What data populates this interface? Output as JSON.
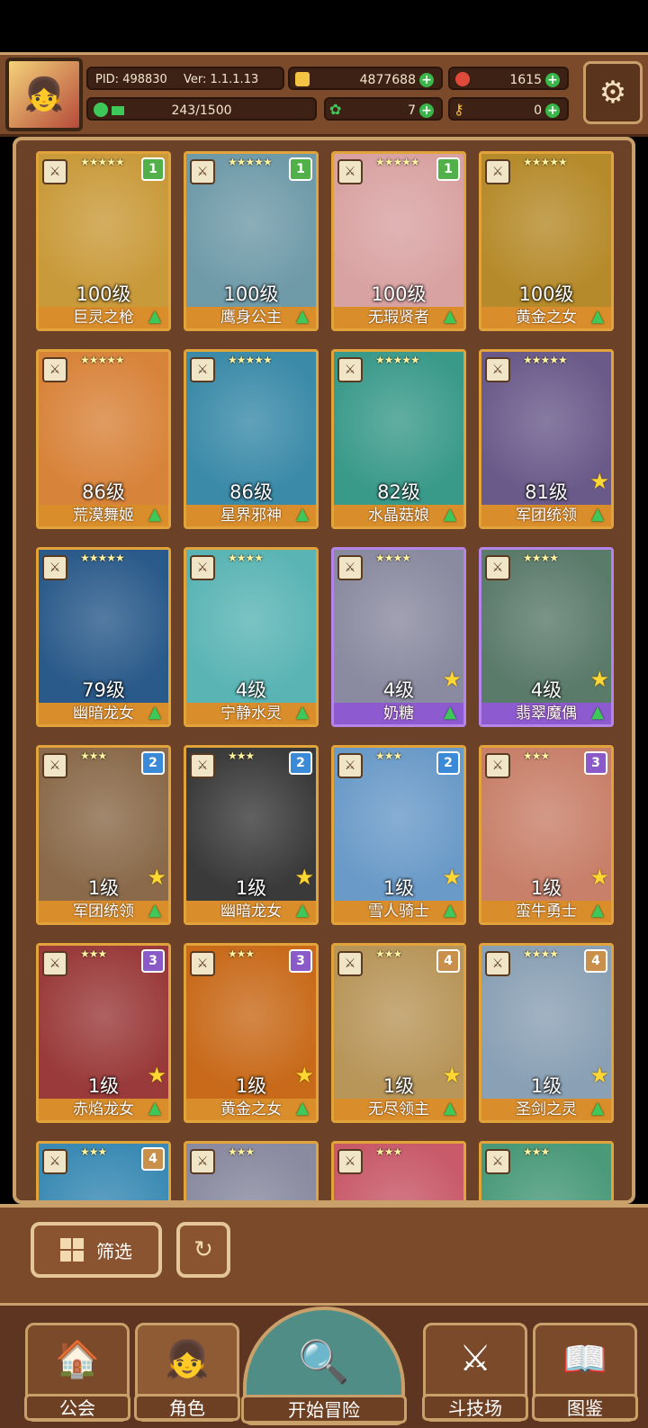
{
  "header": {
    "pid": "PID: 498830",
    "version": "Ver: 1.1.1.13",
    "gold": "4877688",
    "gems": "1615",
    "exp": "243/1500",
    "clover": "7",
    "keys": "0"
  },
  "cards": [
    {
      "stars": "★★★★★",
      "rank": "1",
      "rank_color": "#52b04a",
      "level": "100级",
      "name": "巨灵之枪",
      "art": "#c99a3a",
      "purple": false,
      "star_badge": false
    },
    {
      "stars": "★★★★★",
      "rank": "1",
      "rank_color": "#52b04a",
      "level": "100级",
      "name": "鹰身公主",
      "art": "#6f9aa8",
      "purple": false,
      "star_badge": false
    },
    {
      "stars": "★★★★★",
      "rank": "1",
      "rank_color": "#52b04a",
      "level": "100级",
      "name": "无瑕贤者",
      "art": "#d9a2a2",
      "purple": false,
      "star_badge": false
    },
    {
      "stars": "★★★★★",
      "rank": "",
      "rank_color": "",
      "level": "100级",
      "name": "黄金之女",
      "art": "#b58a2a",
      "purple": false,
      "star_badge": false
    },
    {
      "stars": "★★★★★",
      "rank": "",
      "rank_color": "",
      "level": "86级",
      "name": "荒漠舞姬",
      "art": "#d8833a",
      "purple": false,
      "star_badge": false
    },
    {
      "stars": "★★★★★",
      "rank": "",
      "rank_color": "",
      "level": "86级",
      "name": "星界邪神",
      "art": "#3a8aa8",
      "purple": false,
      "star_badge": false
    },
    {
      "stars": "★★★★★",
      "rank": "",
      "rank_color": "",
      "level": "82级",
      "name": "水晶菇娘",
      "art": "#3a9a8a",
      "purple": false,
      "star_badge": false
    },
    {
      "stars": "★★★★★",
      "rank": "",
      "rank_color": "",
      "level": "81级",
      "name": "军团统领",
      "art": "#6a5a8a",
      "purple": false,
      "star_badge": true
    },
    {
      "stars": "★★★★★",
      "rank": "",
      "rank_color": "",
      "level": "79级",
      "name": "幽暗龙女",
      "art": "#2a5a8a",
      "purple": false,
      "star_badge": false
    },
    {
      "stars": "★★★★",
      "rank": "",
      "rank_color": "",
      "level": "4级",
      "name": "宁静水灵",
      "art": "#5ab4b4",
      "purple": false,
      "star_badge": false
    },
    {
      "stars": "★★★★",
      "rank": "",
      "rank_color": "",
      "level": "4级",
      "name": "奶糖",
      "art": "#8a8aa0",
      "purple": true,
      "star_badge": true
    },
    {
      "stars": "★★★★",
      "rank": "",
      "rank_color": "",
      "level": "4级",
      "name": "翡翠魔偶",
      "art": "#5a7a6a",
      "purple": true,
      "star_badge": true
    },
    {
      "stars": "★★★",
      "rank": "2",
      "rank_color": "#3a8ad8",
      "level": "1级",
      "name": "军团统领",
      "art": "#8a6a4a",
      "purple": false,
      "star_badge": true
    },
    {
      "stars": "★★★",
      "rank": "2",
      "rank_color": "#3a8ad8",
      "level": "1级",
      "name": "幽暗龙女",
      "art": "#3a3a3a",
      "purple": false,
      "star_badge": true
    },
    {
      "stars": "★★★",
      "rank": "2",
      "rank_color": "#3a8ad8",
      "level": "1级",
      "name": "雪人骑士",
      "art": "#6a9ac8",
      "purple": false,
      "star_badge": true
    },
    {
      "stars": "★★★",
      "rank": "3",
      "rank_color": "#8a5ac8",
      "level": "1级",
      "name": "蛮牛勇士",
      "art": "#c8806a",
      "purple": false,
      "star_badge": true
    },
    {
      "stars": "★★★",
      "rank": "3",
      "rank_color": "#8a5ac8",
      "level": "1级",
      "name": "赤焰龙女",
      "art": "#9a3a3a",
      "purple": false,
      "star_badge": true
    },
    {
      "stars": "★★★",
      "rank": "3",
      "rank_color": "#8a5ac8",
      "level": "1级",
      "name": "黄金之女",
      "art": "#c86a1a",
      "purple": false,
      "star_badge": true
    },
    {
      "stars": "★★★",
      "rank": "4",
      "rank_color": "#c8904a",
      "level": "1级",
      "name": "无尽领主",
      "art": "#b8965a",
      "purple": false,
      "star_badge": true
    },
    {
      "stars": "★★★★",
      "rank": "4",
      "rank_color": "#c8904a",
      "level": "1级",
      "name": "圣剑之灵",
      "art": "#8aa0b4",
      "purple": false,
      "star_badge": true
    },
    {
      "stars": "★★★",
      "rank": "4",
      "rank_color": "#c8904a",
      "level": "",
      "name": "",
      "art": "#3a8ab4",
      "purple": false,
      "star_badge": false
    },
    {
      "stars": "★★★",
      "rank": "",
      "rank_color": "",
      "level": "",
      "name": "",
      "art": "#8a8aa0",
      "purple": false,
      "star_badge": false
    },
    {
      "stars": "★★★",
      "rank": "",
      "rank_color": "",
      "level": "",
      "name": "",
      "art": "#c85a6a",
      "purple": false,
      "star_badge": false
    },
    {
      "stars": "★★★",
      "rank": "",
      "rank_color": "",
      "level": "",
      "name": "",
      "art": "#4a9a7a",
      "purple": false,
      "star_badge": false
    }
  ],
  "filter": {
    "label": "筛选"
  },
  "nav": {
    "guild": "公会",
    "character": "角色",
    "adventure": "开始冒险",
    "arena": "斗技场",
    "codex": "图鉴"
  }
}
